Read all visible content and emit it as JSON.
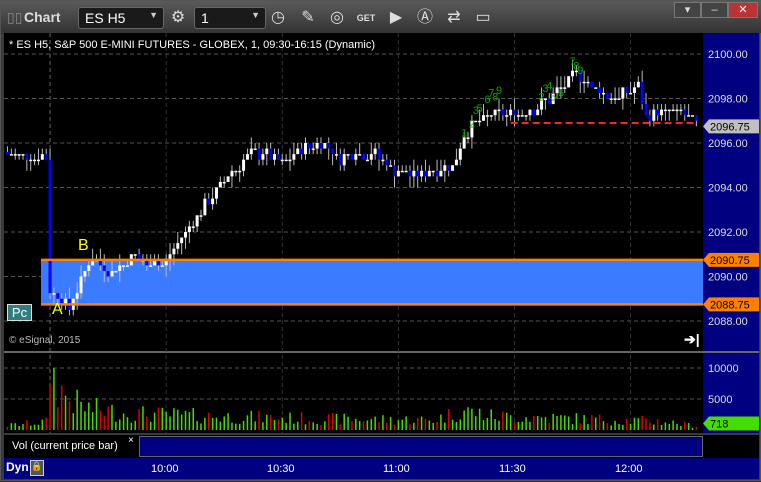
{
  "window": {
    "title": "Chart",
    "symbol": "ES H5",
    "interval": "1"
  },
  "chart_header": "* ES H5, S&P 500 E-MINI FUTURES - GLOBEX, 1, 09:30-16:15 (Dynamic)",
  "copyright": "© eSignal, 2015",
  "pc_button": "Pc",
  "labels": {
    "a": "A",
    "b": "B"
  },
  "volume_study": {
    "label": "Vol (current price bar)",
    "close": "×"
  },
  "dyn_label": "Dyn",
  "colors": {
    "up": "#ffffff",
    "down": "#0000ff",
    "band": "#3a7bff",
    "level": "#ff8000",
    "axis_bg": "#000080",
    "vol_up": "#44dd00",
    "vol_down": "#dd0000",
    "td": "#00aa00",
    "ref_line": "#ff2020"
  },
  "chart_data": {
    "type": "candlestick",
    "title": "ES H5, S&P 500 E-MINI FUTURES - GLOBEX, 1",
    "x_start": "09:19",
    "bar_minutes": 1,
    "price_axis": {
      "ticks": [
        "2100.00",
        "2098.00",
        "2096.00",
        "2094.00",
        "2092.00",
        "2090.00",
        "2088.00"
      ],
      "tick_values": [
        2100,
        2098,
        2096,
        2094,
        2092,
        2090,
        2088
      ],
      "ylim": [
        2087.3,
        2100.8
      ]
    },
    "volume_axis": {
      "ticks": [
        "10000",
        "5000"
      ],
      "tick_values": [
        10000,
        5000
      ],
      "ylim": [
        0,
        13000
      ]
    },
    "time_axis": {
      "ticks": [
        "10:00",
        "10:30",
        "11:00",
        "11:30",
        "12:00"
      ],
      "tick_minutes": [
        41,
        71,
        101,
        131,
        161
      ]
    },
    "price_keypoints": [
      [
        0,
        2095.6
      ],
      [
        5,
        2095.4
      ],
      [
        10,
        2095.4
      ],
      [
        11,
        2089.3
      ],
      [
        14,
        2089.0
      ],
      [
        16,
        2088.6
      ],
      [
        19,
        2089.8
      ],
      [
        22,
        2090.9
      ],
      [
        24,
        2090.6
      ],
      [
        27,
        2090.2
      ],
      [
        30,
        2090.5
      ],
      [
        33,
        2091.0
      ],
      [
        36,
        2090.5
      ],
      [
        38,
        2090.8
      ],
      [
        40,
        2090.4
      ],
      [
        44,
        2091.4
      ],
      [
        48,
        2092.5
      ],
      [
        52,
        2093.4
      ],
      [
        56,
        2094.3
      ],
      [
        62,
        2095.4
      ],
      [
        66,
        2095.6
      ],
      [
        70,
        2095.1
      ],
      [
        74,
        2095.5
      ],
      [
        78,
        2095.8
      ],
      [
        82,
        2095.9
      ],
      [
        86,
        2095.3
      ],
      [
        90,
        2095.6
      ],
      [
        95,
        2095.5
      ],
      [
        100,
        2094.8
      ],
      [
        105,
        2094.6
      ],
      [
        110,
        2094.8
      ],
      [
        115,
        2095.0
      ],
      [
        118,
        2096.3
      ],
      [
        122,
        2097.1
      ],
      [
        128,
        2097.3
      ],
      [
        133,
        2097.4
      ],
      [
        137,
        2097.6
      ],
      [
        141,
        2098.1
      ],
      [
        145,
        2098.8
      ],
      [
        147,
        2099.2
      ],
      [
        151,
        2098.5
      ],
      [
        155,
        2098.2
      ],
      [
        158,
        2098.0
      ],
      [
        160,
        2098.3
      ],
      [
        163,
        2098.6
      ],
      [
        165,
        2097.2
      ],
      [
        170,
        2097.4
      ],
      [
        174,
        2097.4
      ],
      [
        177,
        2097.0
      ],
      [
        178,
        2096.8
      ]
    ],
    "volume_keypoints": [
      [
        0,
        800
      ],
      [
        10,
        1500
      ],
      [
        11,
        11500
      ],
      [
        13,
        7500
      ],
      [
        16,
        5500
      ],
      [
        20,
        4000
      ],
      [
        30,
        3000
      ],
      [
        50,
        2500
      ],
      [
        80,
        2000
      ],
      [
        110,
        1800
      ],
      [
        118,
        3500
      ],
      [
        125,
        2500
      ],
      [
        150,
        2000
      ],
      [
        170,
        1500
      ],
      [
        178,
        718
      ]
    ],
    "levels": [
      {
        "label": "2090.75",
        "value": 2090.75
      },
      {
        "label": "2088.75",
        "value": 2088.75
      }
    ],
    "reference_line": {
      "value": 2096.9,
      "from_minute": 130,
      "to_minute": 178
    },
    "current_price": "2096.75",
    "current_price_value": 2096.75,
    "current_volume": "718",
    "current_volume_value": 718,
    "td_counts": [
      {
        "text": "1",
        "minute": 118,
        "price": 2096.3
      },
      {
        "text": "2",
        "minute": 120,
        "price": 2096.7
      },
      {
        "text": "3",
        "minute": 121,
        "price": 2097.3
      },
      {
        "text": "5",
        "minute": 122,
        "price": 2097.4
      },
      {
        "text": "6",
        "minute": 124,
        "price": 2097.8
      },
      {
        "text": "7",
        "minute": 125,
        "price": 2098.1
      },
      {
        "text": "8",
        "minute": 126,
        "price": 2097.9
      },
      {
        "text": "9",
        "minute": 127,
        "price": 2098.2
      },
      {
        "text": "2",
        "minute": 138,
        "price": 2097.9
      },
      {
        "text": "3",
        "minute": 139,
        "price": 2098.3
      },
      {
        "text": "4",
        "minute": 140,
        "price": 2098.4
      },
      {
        "text": "5",
        "minute": 141,
        "price": 2097.9
      },
      {
        "text": "6",
        "minute": 143,
        "price": 2098.1
      },
      {
        "text": "7",
        "minute": 146,
        "price": 2099.5
      },
      {
        "text": "8",
        "minute": 147,
        "price": 2099.3
      },
      {
        "text": "9",
        "minute": 148,
        "price": 2099.1
      }
    ]
  }
}
